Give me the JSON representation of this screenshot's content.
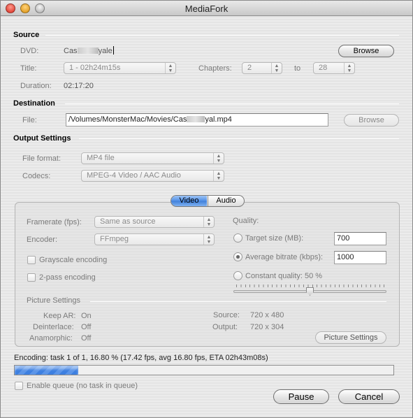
{
  "window": {
    "title": "MediaFork"
  },
  "source": {
    "section_title": "Source",
    "dvd_label": "DVD:",
    "dvd_value_start": "Cas",
    "dvd_value_end": "yale",
    "browse_label": "Browse",
    "title_label": "Title:",
    "title_value": "1 - 02h24m15s",
    "chapters_label": "Chapters:",
    "chapter_from": "2",
    "to_label": "to",
    "chapter_to": "28",
    "duration_label": "Duration:",
    "duration_value": "02:17:20"
  },
  "destination": {
    "section_title": "Destination",
    "file_label": "File:",
    "file_value_start": "/Volumes/MonsterMac/Movies/Cas",
    "file_value_end": "yal.mp4",
    "browse_label": "Browse"
  },
  "output": {
    "section_title": "Output Settings",
    "format_label": "File format:",
    "format_value": "MP4 file",
    "codecs_label": "Codecs:",
    "codecs_value": "MPEG-4 Video / AAC Audio"
  },
  "tabs": [
    {
      "label": "Video",
      "selected": true
    },
    {
      "label": "Audio",
      "selected": false
    }
  ],
  "video": {
    "framerate_label": "Framerate (fps):",
    "framerate_value": "Same as source",
    "encoder_label": "Encoder:",
    "encoder_value": "FFmpeg",
    "grayscale_label": "Grayscale encoding",
    "twopass_label": "2-pass encoding",
    "quality_label": "Quality:",
    "target_size_label": "Target size (MB):",
    "target_size_value": "700",
    "avg_bitrate_label": "Average bitrate (kbps):",
    "avg_bitrate_value": "1000",
    "constant_quality_label": "Constant quality: 50 %",
    "quality_slider_fraction": 0.5,
    "selected_quality_mode": "average_bitrate"
  },
  "picture": {
    "section_title": "Picture Settings",
    "keep_ar_label": "Keep AR:",
    "keep_ar_value": "On",
    "deinterlace_label": "Deinterlace:",
    "deinterlace_value": "Off",
    "anamorphic_label": "Anamorphic:",
    "anamorphic_value": "Off",
    "source_label": "Source:",
    "source_value": "720 x 480",
    "output_label": "Output:",
    "output_value": "720 x 304",
    "button_label": "Picture Settings"
  },
  "status": {
    "encoding_text": "Encoding: task 1 of 1, 16.80 % (17.42 fps, avg 16.80 fps, ETA 02h43m08s)",
    "progress_fraction": 0.168
  },
  "queue": {
    "enable_label": "Enable queue (no task in queue)"
  },
  "buttons": {
    "pause": "Pause",
    "cancel": "Cancel"
  },
  "colors": {
    "accent": "#4f8ee6",
    "progress": "#3d7fe0"
  }
}
